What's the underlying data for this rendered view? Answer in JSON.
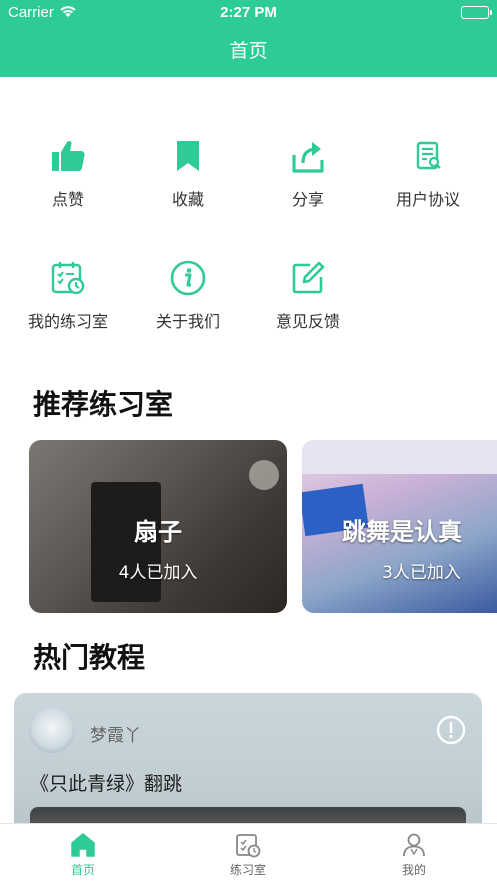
{
  "status_bar": {
    "carrier": "Carrier",
    "time": "2:27 PM",
    "wifi_icon": "wifi-icon",
    "battery_icon": "battery-icon"
  },
  "nav": {
    "title": "首页"
  },
  "quick_actions": [
    {
      "label": "点赞",
      "icon": "thumbs-up-icon"
    },
    {
      "label": "收藏",
      "icon": "bookmark-icon"
    },
    {
      "label": "分享",
      "icon": "share-icon"
    },
    {
      "label": "用户协议",
      "icon": "agreement-icon"
    },
    {
      "label": "我的练习室",
      "icon": "calendar-check-icon"
    },
    {
      "label": "关于我们",
      "icon": "info-icon"
    },
    {
      "label": "意见反馈",
      "icon": "edit-icon"
    }
  ],
  "recommended": {
    "title": "推荐练习室",
    "rooms": [
      {
        "title": "扇子",
        "joined": "4人已加入"
      },
      {
        "title": "跳舞是认真",
        "joined": "3人已加入"
      }
    ]
  },
  "tutorials": {
    "title": "热门教程",
    "items": [
      {
        "author": "梦霞丫",
        "title": "《只此青绿》翻跳",
        "more_icon": "alert-circle-icon"
      }
    ]
  },
  "tabbar": {
    "items": [
      {
        "label": "首页",
        "icon": "home-icon",
        "active": true
      },
      {
        "label": "练习室",
        "icon": "practice-room-icon",
        "active": false
      },
      {
        "label": "我的",
        "icon": "profile-icon",
        "active": false
      }
    ]
  },
  "colors": {
    "primary": "#2ecb95",
    "text": "#333333",
    "tab_inactive": "#999999"
  }
}
